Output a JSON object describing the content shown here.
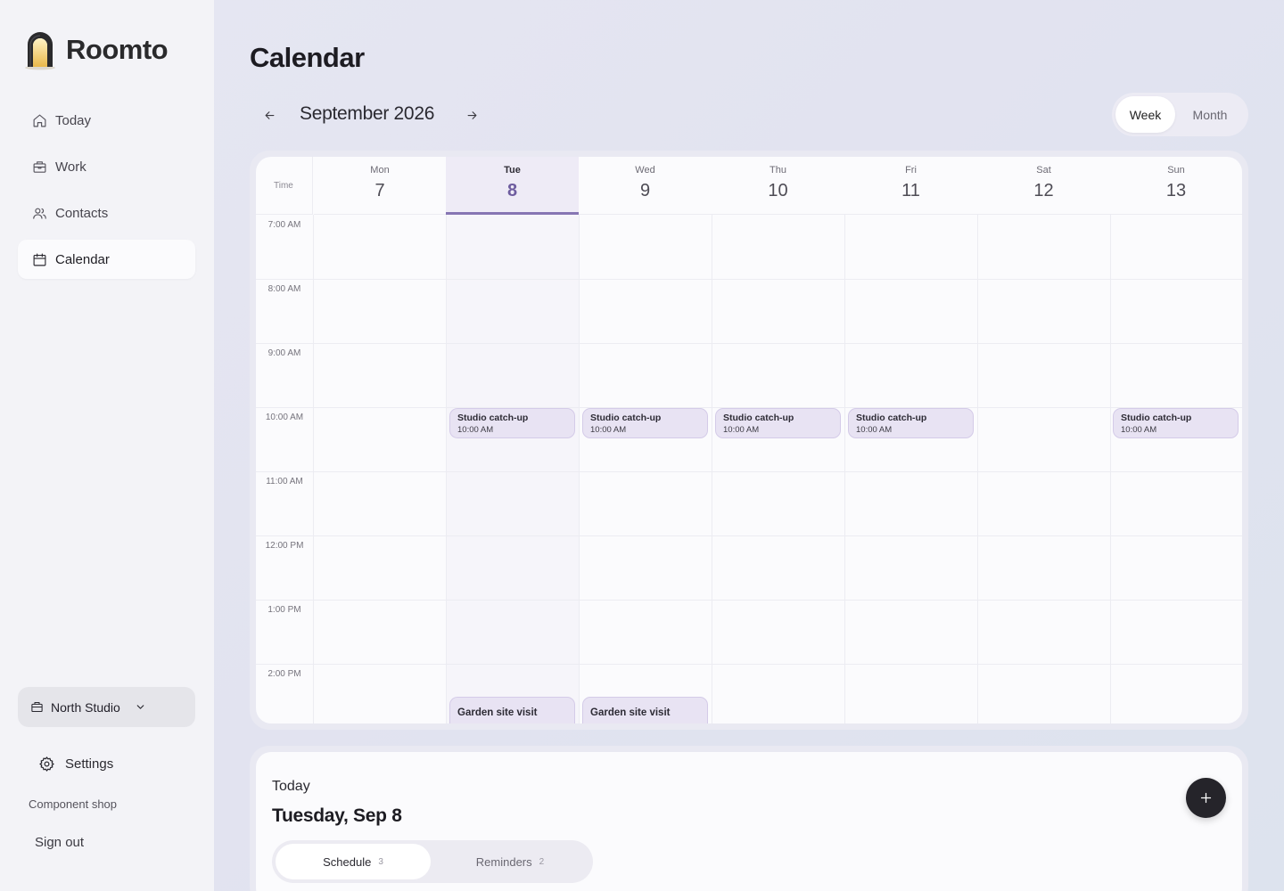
{
  "brand": {
    "name": "Roomto"
  },
  "sidebar": {
    "items": [
      {
        "label": "Today",
        "icon": "home-icon"
      },
      {
        "label": "Work",
        "icon": "briefcase-icon"
      },
      {
        "label": "Contacts",
        "icon": "users-icon"
      },
      {
        "label": "Calendar",
        "icon": "calendar-icon",
        "active": true
      }
    ],
    "org": "North Studio",
    "settings": "Settings",
    "component_shop": "Component shop",
    "sign_out": "Sign out"
  },
  "page": {
    "title": "Calendar",
    "month": "September 2026"
  },
  "view_toggle": {
    "week": "Week",
    "month": "Month",
    "selected": "Week"
  },
  "calendar": {
    "time_header": "Time",
    "days": [
      {
        "name": "Mon",
        "date": "7"
      },
      {
        "name": "Tue",
        "date": "8",
        "today": true
      },
      {
        "name": "Wed",
        "date": "9"
      },
      {
        "name": "Thu",
        "date": "10"
      },
      {
        "name": "Fri",
        "date": "11"
      },
      {
        "name": "Sat",
        "date": "12"
      },
      {
        "name": "Sun",
        "date": "13"
      }
    ],
    "hours": [
      "7:00 AM",
      "8:00 AM",
      "9:00 AM",
      "10:00 AM",
      "11:00 AM",
      "12:00 PM",
      "1:00 PM",
      "2:00 PM"
    ],
    "events": [
      {
        "title": "Studio catch-up",
        "time": "10:00 AM",
        "day": "Tue"
      },
      {
        "title": "Studio catch-up",
        "time": "10:00 AM",
        "day": "Wed"
      },
      {
        "title": "Studio catch-up",
        "time": "10:00 AM",
        "day": "Thu"
      },
      {
        "title": "Studio catch-up",
        "time": "10:00 AM",
        "day": "Fri"
      },
      {
        "title": "Studio catch-up",
        "time": "10:00 AM",
        "day": "Sun"
      },
      {
        "title": "Garden site visit",
        "day": "Tue"
      },
      {
        "title": "Garden site visit",
        "day": "Wed"
      }
    ]
  },
  "today_panel": {
    "label": "Today",
    "date": "Tuesday, Sep 8",
    "tabs": [
      {
        "label": "Schedule",
        "count": "3"
      },
      {
        "label": "Reminders",
        "count": "2"
      }
    ]
  },
  "colors": {
    "accent": "#8676b3",
    "event_bg": "#e8e3f3",
    "fab": "#25242a"
  }
}
